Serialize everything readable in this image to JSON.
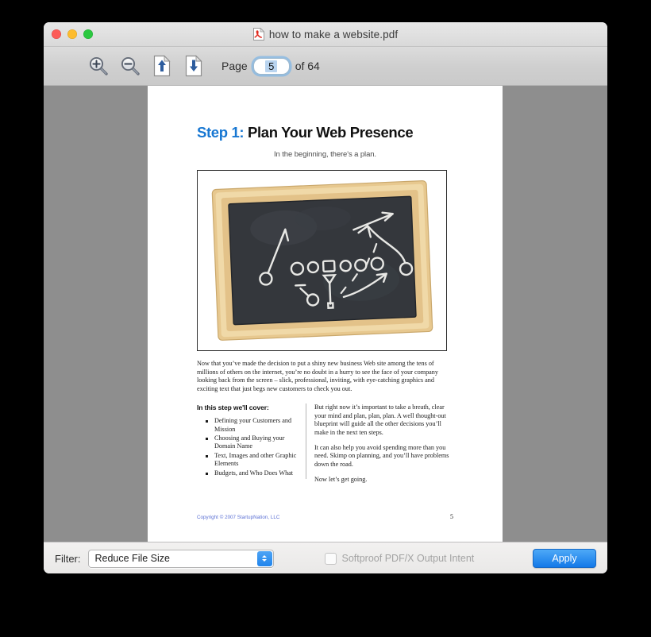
{
  "window": {
    "title": "how to make a website.pdf",
    "title_icon": "pdf-file-icon",
    "traffic_lights": [
      {
        "name": "close",
        "color": "#fc5b57"
      },
      {
        "name": "minimize",
        "color": "#fdbc2e"
      },
      {
        "name": "maximize",
        "color": "#2bc840"
      }
    ]
  },
  "toolbar": {
    "buttons": [
      {
        "name": "zoom-in-icon",
        "tooltip": "Zoom In"
      },
      {
        "name": "zoom-out-icon",
        "tooltip": "Zoom Out"
      },
      {
        "name": "page-up-icon",
        "tooltip": "Previous Page"
      },
      {
        "name": "page-down-icon",
        "tooltip": "Next Page"
      }
    ],
    "page_label": "Page",
    "page_value": "5",
    "page_of": "of 64",
    "total_pages": 64
  },
  "document": {
    "background_color": "#8e8e8e",
    "title_step": "Step 1:",
    "title_rest": "Plan Your Web Presence",
    "title_step_color": "#1777d2",
    "subtitle": "In the beginning, there's a plan.",
    "image_alt": "chalkboard-football-play-diagram",
    "intro_paragraph": "Now that you’ve made the decision to put a shiny new business Web site among the tens of millions of others on the internet, you’re no doubt in a hurry to see the face of your company looking back from the screen – slick, professional, inviting, with eye-catching graphics and exciting text that just begs new customers to check you out.",
    "cover_heading": "In this step we'll cover:",
    "cover_items": [
      "Defining your Customers and Mission",
      "Choosing and Buying your Domain Name",
      "Text, Images and other Graphic Elements",
      "Budgets, and Who Does What"
    ],
    "right_paragraphs": [
      "But right now it’s important to take a breath, clear your mind and plan, plan, plan. A well thought-out blueprint will guide all the other decisions you’ll make in the next ten steps.",
      "It can also help you avoid spending more than you need. Skimp on planning, and you’ll have problems down the road.",
      "Now let’s get going."
    ],
    "copyright": "Copyright © 2007 StartupNation, LLC",
    "copyright_color": "#5a6fd4",
    "footer_page_number": "5"
  },
  "bottom_bar": {
    "filter_label": "Filter:",
    "filter_value": "Reduce File Size",
    "softproof_label": "Softproof PDF/X Output Intent",
    "softproof_checked": false,
    "apply_label": "Apply",
    "apply_color": "#1379e8"
  }
}
